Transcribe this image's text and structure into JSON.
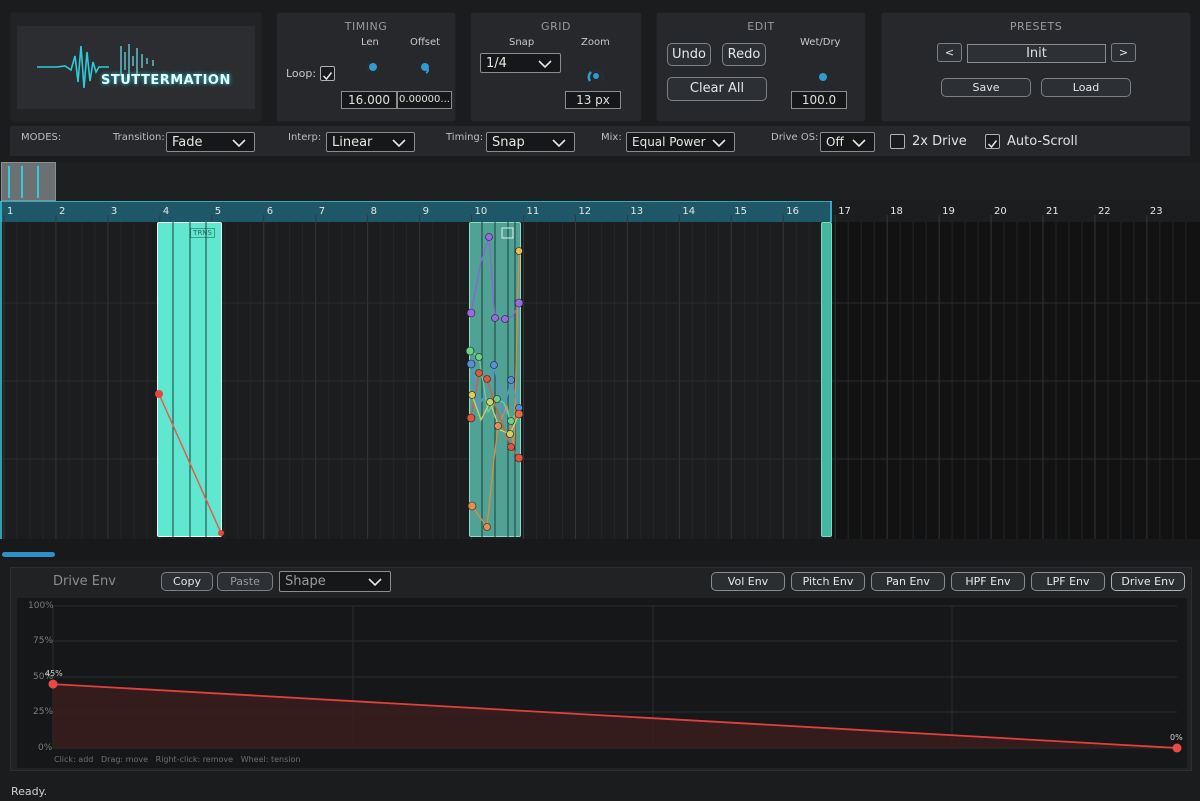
{
  "app": {
    "title": "STUTTERMATION",
    "status": "Ready."
  },
  "timing": {
    "title": "TIMING",
    "loop_label": "Loop:",
    "loop_checked": true,
    "len_label": "Len",
    "offset_label": "Offset",
    "len_value": "16.000",
    "offset_value": "0.00000..."
  },
  "grid": {
    "title": "GRID",
    "snap_label": "Snap",
    "zoom_label": "Zoom",
    "snap_value": "1/4",
    "zoom_value": "13 px"
  },
  "edit": {
    "title": "EDIT",
    "undo": "Undo",
    "redo": "Redo",
    "clear_all": "Clear All",
    "wetdry_label": "Wet/Dry",
    "wetdry_value": "100.0"
  },
  "presets": {
    "title": "PRESETS",
    "prev": "<",
    "next": ">",
    "current": "Init",
    "save": "Save",
    "load": "Load"
  },
  "modes": {
    "label": "MODES:",
    "transition_label": "Transition:",
    "transition_value": "Fade",
    "interp_label": "Interp:",
    "interp_value": "Linear",
    "timing_label": "Timing:",
    "timing_value": "Snap",
    "mix_label": "Mix:",
    "mix_value": "Equal Power",
    "driveos_label": "Drive OS:",
    "driveos_value": "Off",
    "drive2x_label": "2x Drive",
    "drive2x_checked": false,
    "autoscroll_label": "Auto-Scroll",
    "autoscroll_checked": true
  },
  "timeline": {
    "ruler": [
      "1",
      "2",
      "3",
      "4",
      "5",
      "6",
      "7",
      "8",
      "9",
      "10",
      "11",
      "12",
      "13",
      "14",
      "15",
      "16",
      "17",
      "18",
      "19",
      "20",
      "21",
      "22",
      "23"
    ],
    "block_tag": "TRNS"
  },
  "envelope": {
    "title": "Drive Env",
    "copy": "Copy",
    "paste": "Paste",
    "shape_placeholder": "Shape",
    "tabs": [
      "Vol Env",
      "Pitch Env",
      "Pan Env",
      "HPF Env",
      "LPF Env",
      "Drive Env"
    ],
    "active_tab": "Drive Env",
    "y_labels": [
      "100%",
      "75%",
      "50%",
      "25%",
      "0%"
    ],
    "start_label": "45%",
    "end_label": "0%",
    "start_value_pct": 45,
    "end_value_pct": 0,
    "hint": "Click: add   Drag: move   Right-click: remove   Wheel: tension"
  },
  "colors": {
    "accent": "#1fc1d8",
    "block": "#5ee8cf",
    "env_line": "#e0413f"
  }
}
